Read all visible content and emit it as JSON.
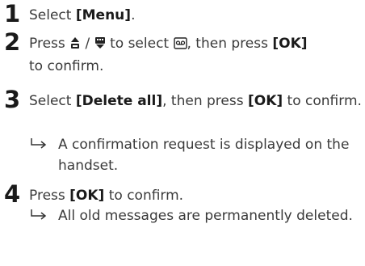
{
  "steps": [
    {
      "number": "1",
      "pre": "Select ",
      "bold1": "[Menu]",
      "post": "."
    },
    {
      "number": "2",
      "pre": "Press ",
      "separator": " / ",
      "mid": " to select ",
      "mid2": ", then press ",
      "bold1": "[OK]",
      "post": "to confirm.",
      "icons": [
        "up-nav-icon",
        "down-nav-icon",
        "voicemail-icon"
      ]
    },
    {
      "number": "3",
      "pre": "Select ",
      "bold1": "[Delete all]",
      "mid": ", then press ",
      "bold2": "[OK]",
      "post": " to confirm.",
      "result": "A confirmation request is displayed on the handset."
    },
    {
      "number": "4",
      "pre": "Press ",
      "bold1": "[OK]",
      "post": " to confirm.",
      "result": "All old messages are permanently deleted."
    }
  ]
}
